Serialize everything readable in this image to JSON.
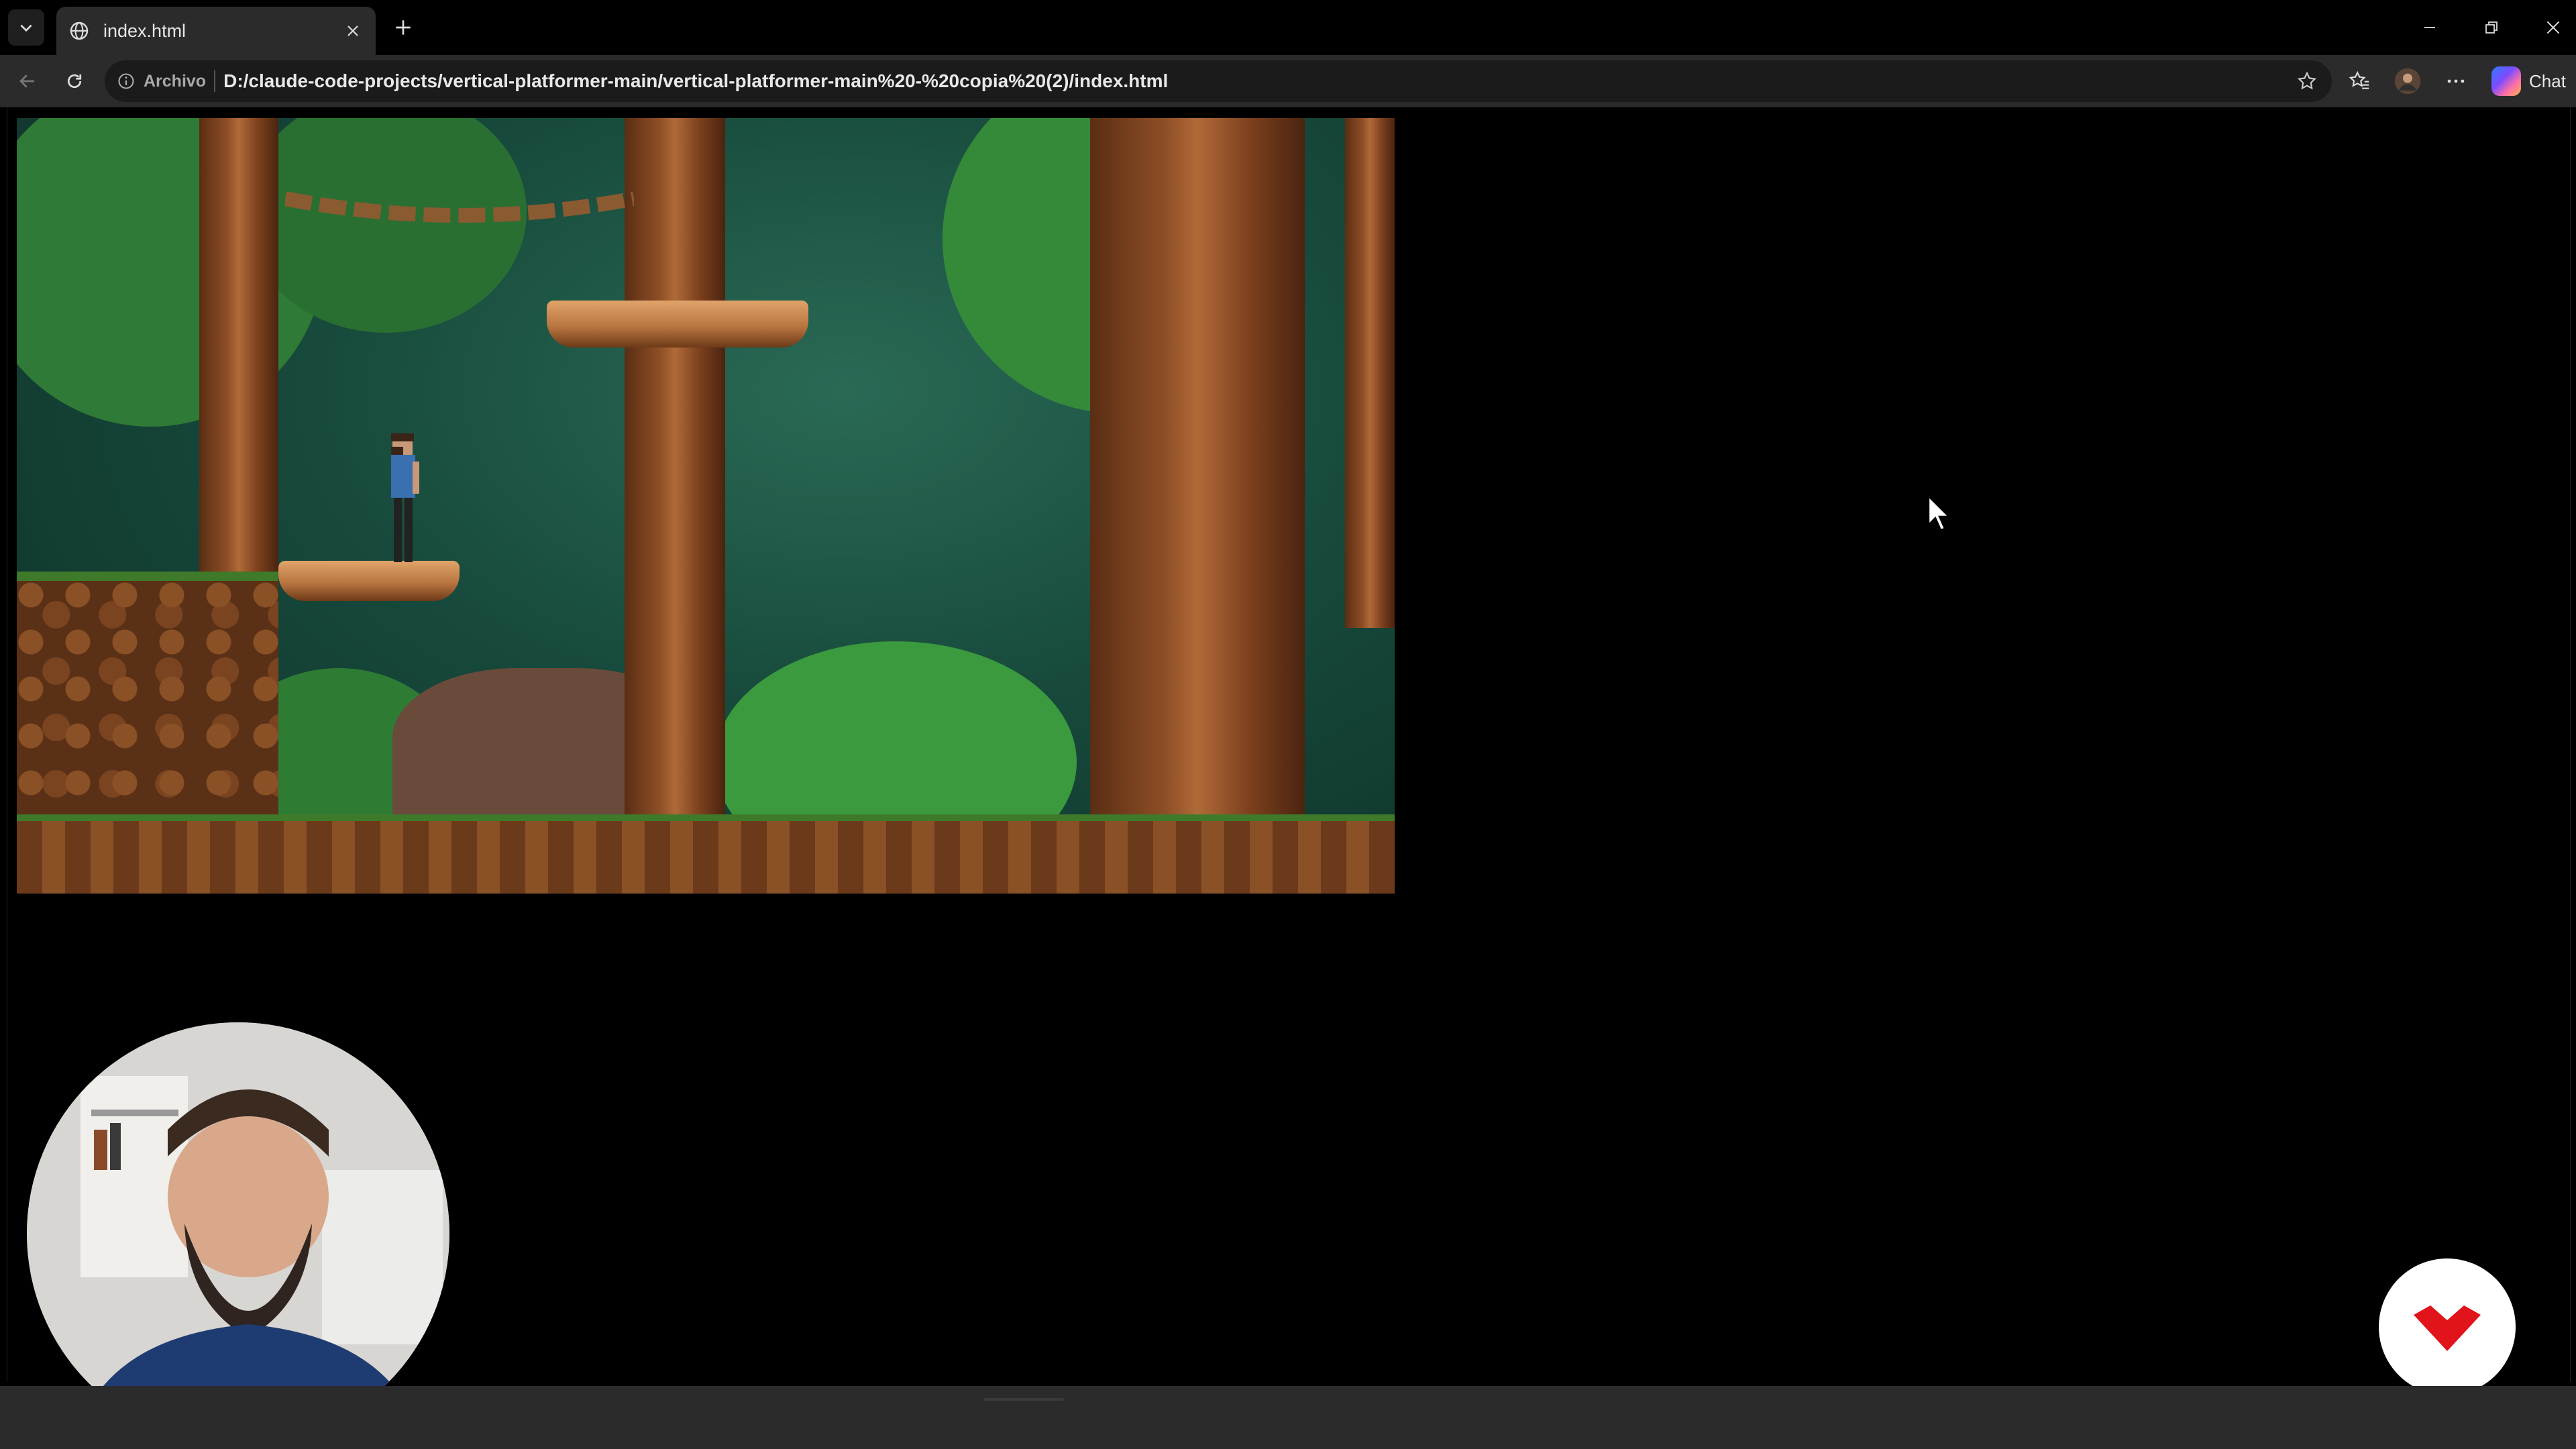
{
  "browser": {
    "tab": {
      "title": "index.html"
    },
    "address_bar": {
      "badge": "Archivo",
      "url": "D:/claude-code-projects/vertical-platformer-main/vertical-platformer-main%20-%20copia%20(2)/index.html"
    },
    "chat_label": "Chat"
  },
  "icons": {
    "tab_list": "chevron-down-icon",
    "favicon": "globe-icon",
    "close_tab": "close-icon",
    "new_tab": "plus-icon",
    "back": "arrow-left-icon",
    "reload": "reload-icon",
    "site_info": "info-icon",
    "favorite": "star-icon",
    "favorites": "favorites-icon",
    "profile": "avatar-icon",
    "more": "more-icon",
    "minimize": "minimize-icon",
    "restore": "restore-icon",
    "close_window": "close-icon"
  },
  "colors": {
    "tab_bg": "#2b2b2b",
    "toolbar_bg": "#2b2b2b",
    "omnibox_bg": "#1b1b1b",
    "page_bg": "#000000",
    "brand_red": "#e1131b"
  }
}
